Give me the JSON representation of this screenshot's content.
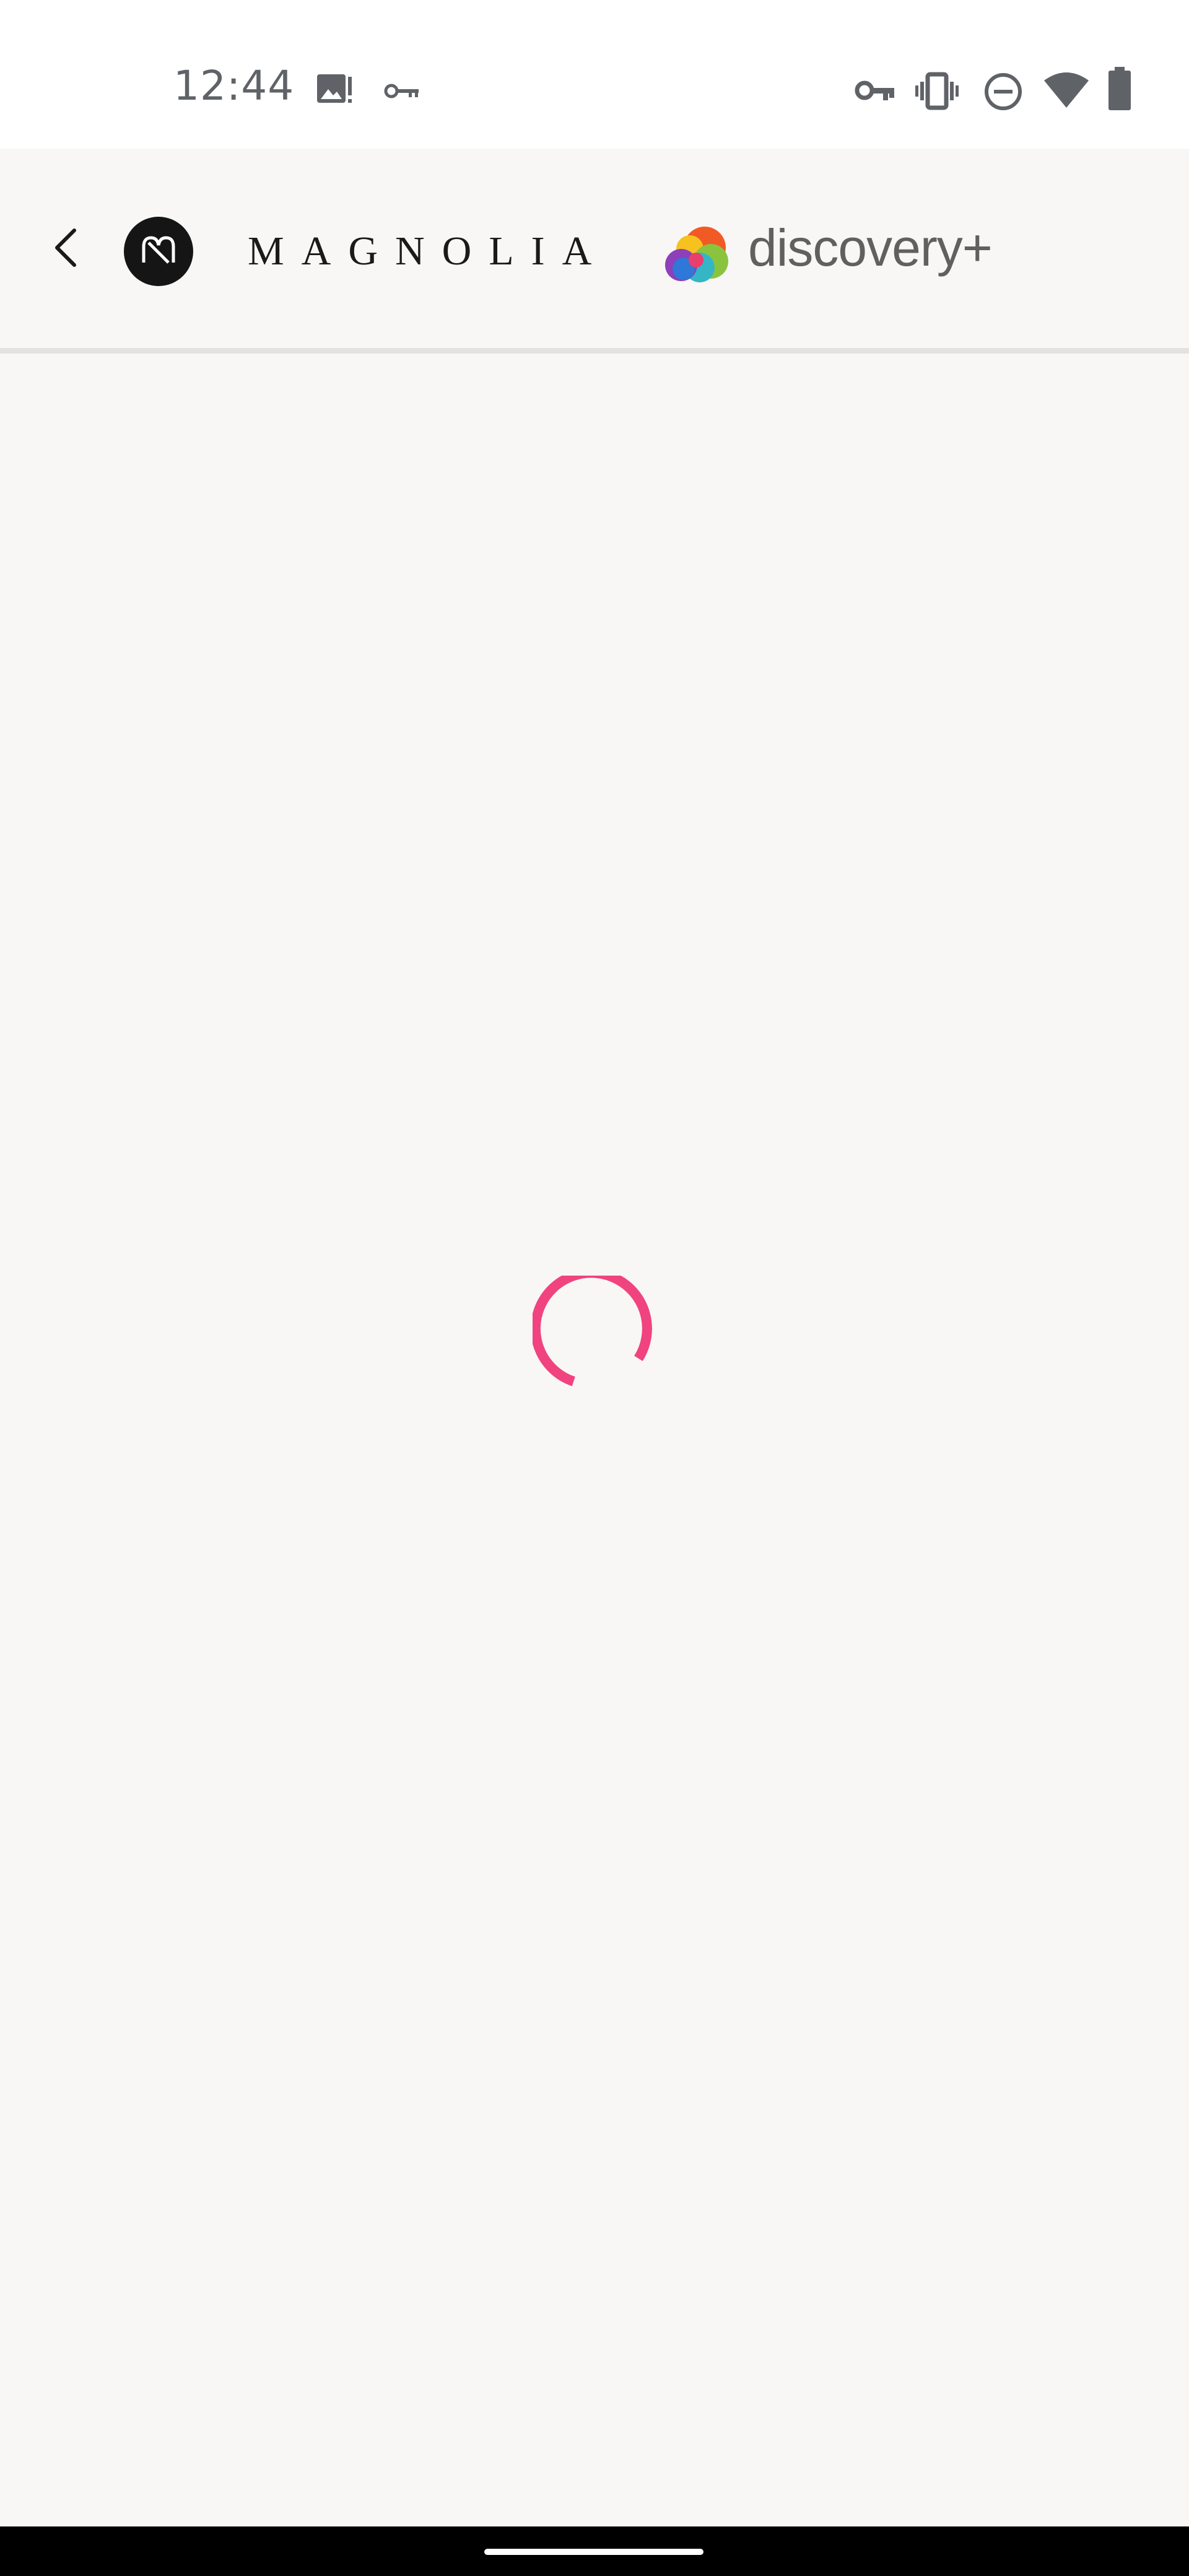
{
  "status_bar": {
    "time": "12:44",
    "left_icons": [
      "image-alert-icon",
      "key-icon"
    ],
    "right_icons": [
      "vpn-key-icon",
      "vibrate-icon",
      "do-not-disturb-icon",
      "wifi-icon",
      "battery-icon"
    ]
  },
  "header": {
    "back_icon": "chevron-left-icon",
    "brand_logo": "magnolia-logo",
    "brand_name": "MAGNOLIA",
    "partner_logo": "discovery-plus-logo",
    "partner_name": "discovery+"
  },
  "content": {
    "state": "loading",
    "spinner_color": "#f0437f"
  },
  "colors": {
    "status_text": "#5f6368",
    "header_background": "#f8f7f5",
    "divider": "#e4e2df",
    "accent": "#f0437f"
  }
}
